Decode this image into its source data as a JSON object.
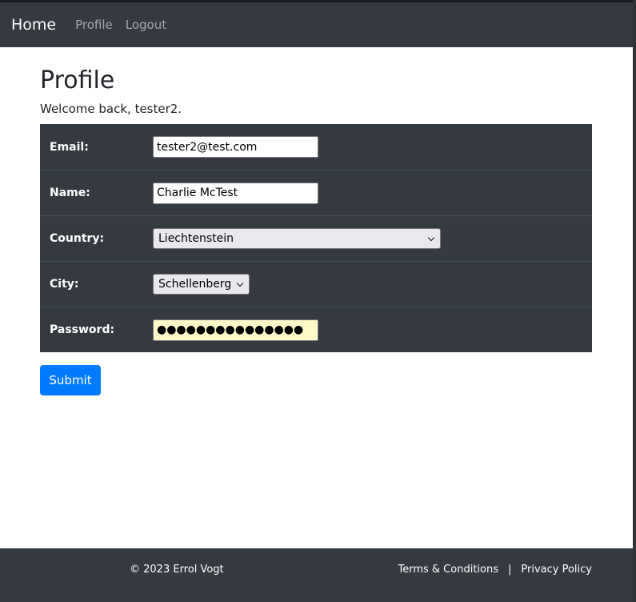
{
  "nav": {
    "brand": "Home",
    "links": [
      "Profile",
      "Logout"
    ]
  },
  "main": {
    "title": "Profile",
    "welcome": "Welcome back, tester2."
  },
  "form": {
    "email_label": "Email:",
    "email_value": "tester2@test.com",
    "name_label": "Name:",
    "name_value": "Charlie McTest",
    "country_label": "Country:",
    "country_value": "Liechtenstein",
    "city_label": "City:",
    "city_value": "Schellenberg",
    "password_label": "Password:",
    "password_value": "●●●●●●●●●●●●●●●",
    "submit_label": "Submit"
  },
  "footer": {
    "copyright": "© 2023 Errol Vogt",
    "terms": "Terms & Conditions",
    "separator": "|",
    "privacy": "Privacy Policy"
  },
  "colors": {
    "navbar": "#343a40",
    "primary": "#007bff",
    "autofill": "#fdfac8"
  }
}
